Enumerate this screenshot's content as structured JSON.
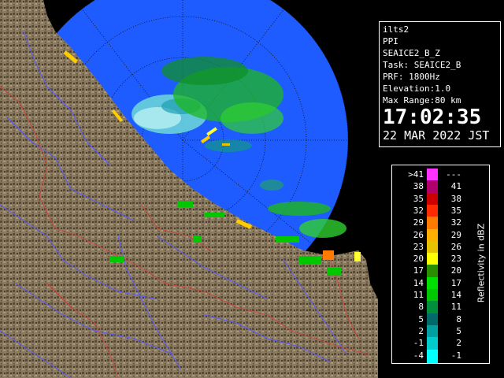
{
  "info": {
    "site": "ilts2",
    "scan_type": "PPI",
    "product": "SEAICE2_B_Z",
    "task": "Task: SEAICE2_B",
    "prf": "PRF: 1800Hz",
    "elevation": "Elevation:1.0",
    "max_range": "Max Range:80 km",
    "time": "17:02:35",
    "date": "22 MAR 2022 JST"
  },
  "legend": {
    "title": "Reflectivity in dBZ",
    "rows": [
      {
        "lo": ">41",
        "hi": "---",
        "color": "#ff33ff"
      },
      {
        "lo": "38",
        "hi": "41",
        "color": "#b0006a"
      },
      {
        "lo": "35",
        "hi": "38",
        "color": "#cc0000"
      },
      {
        "lo": "32",
        "hi": "35",
        "color": "#ff2a00"
      },
      {
        "lo": "29",
        "hi": "32",
        "color": "#ff7a00"
      },
      {
        "lo": "26",
        "hi": "29",
        "color": "#ffb000"
      },
      {
        "lo": "23",
        "hi": "26",
        "color": "#e6c300"
      },
      {
        "lo": "20",
        "hi": "23",
        "color": "#ffff00"
      },
      {
        "lo": "17",
        "hi": "20",
        "color": "#2a8f00"
      },
      {
        "lo": "14",
        "hi": "17",
        "color": "#00e000"
      },
      {
        "lo": "11",
        "hi": "14",
        "color": "#00c800"
      },
      {
        "lo": "8",
        "hi": "11",
        "color": "#008f3a"
      },
      {
        "lo": "5",
        "hi": "8",
        "color": "#006a6a"
      },
      {
        "lo": "2",
        "hi": "5",
        "color": "#00a0a0"
      },
      {
        "lo": "-1",
        "hi": "2",
        "color": "#00cccc"
      },
      {
        "lo": "-4",
        "hi": "-1",
        "color": "#00ffff"
      }
    ]
  },
  "colors": {
    "radar_disc": "#1e5cff",
    "outer_sea": "#000000",
    "land": "#8a7a60",
    "land_dark": "#4a3e2c",
    "river": "#5a5aff",
    "border": "#d0403a"
  }
}
